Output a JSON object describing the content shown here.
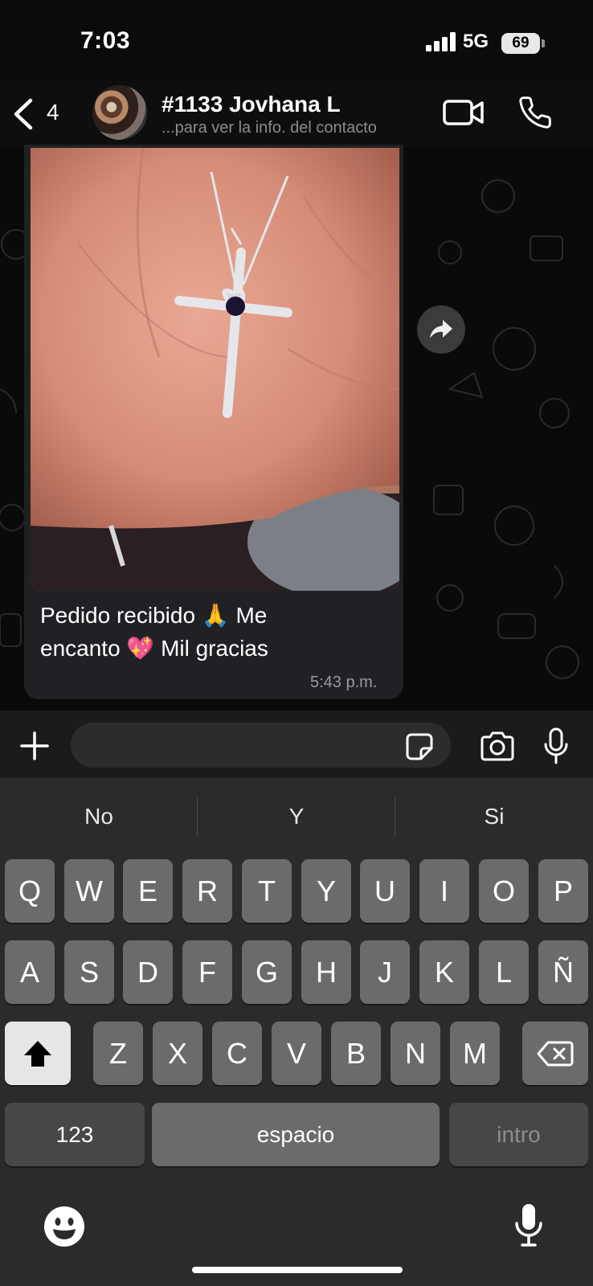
{
  "status_bar": {
    "time": "7:03",
    "network": "5G",
    "battery": "69"
  },
  "header": {
    "back_count": "4",
    "contact_name": "#1133 Jovhana L",
    "contact_subtitle": "...para ver la info. del contacto"
  },
  "message": {
    "text_line1": "Pedido recibido 🙏 Me",
    "text_line2": "encanto 💖 Mil gracias",
    "time": "5:43 p.m."
  },
  "input": {
    "placeholder": ""
  },
  "keyboard": {
    "suggestions": [
      "No",
      "Y",
      "Si"
    ],
    "row1": [
      "Q",
      "W",
      "E",
      "R",
      "T",
      "Y",
      "U",
      "I",
      "O",
      "P"
    ],
    "row2": [
      "A",
      "S",
      "D",
      "F",
      "G",
      "H",
      "J",
      "K",
      "L",
      "Ñ"
    ],
    "row3": [
      "Z",
      "X",
      "C",
      "V",
      "B",
      "N",
      "M"
    ],
    "numbers_label": "123",
    "space_label": "espacio",
    "return_label": "intro"
  },
  "colors": {
    "background": "#0b0b0b",
    "bubble": "#202124",
    "keyboard": "#2b2b2b",
    "key": "#6b6b6b"
  }
}
